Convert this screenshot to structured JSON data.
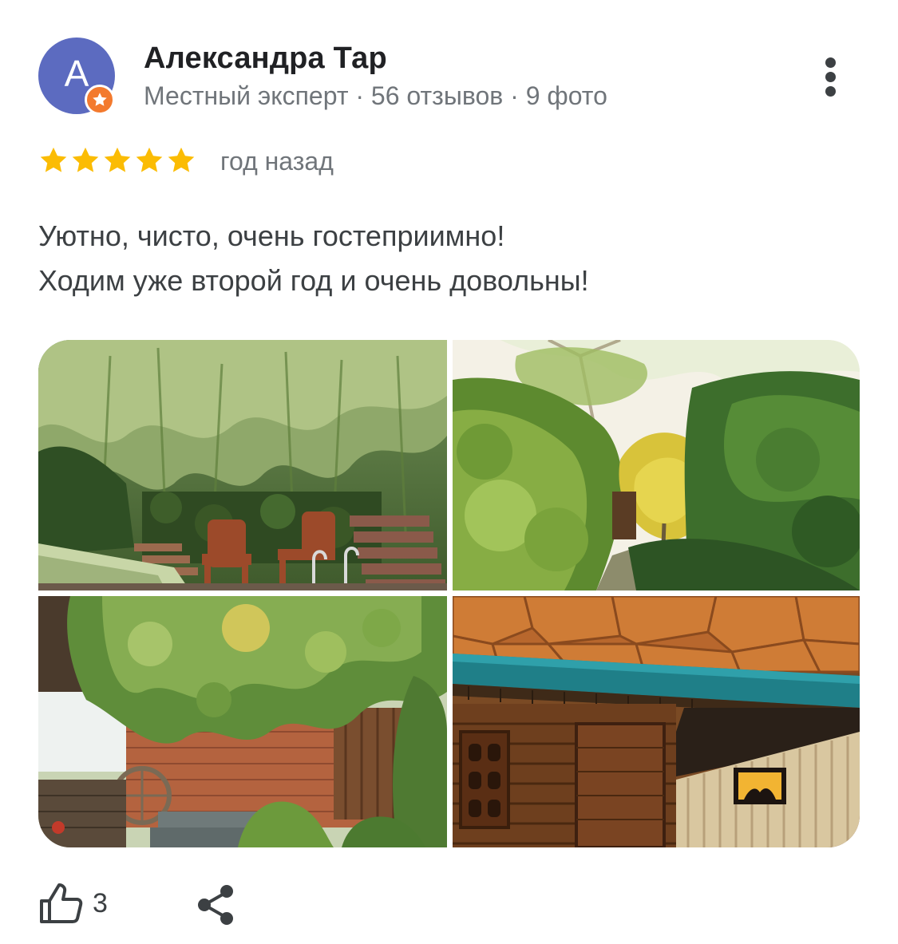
{
  "author": {
    "avatar_letter": "A",
    "avatar_color": "#5c6bc0",
    "badge_icon": "local-guide-star-icon",
    "badge_color": "#f37a2e",
    "name": "Александра Тар",
    "meta": "Местный эксперт · 56 отзывов · 9 фото"
  },
  "rating": {
    "stars": 5,
    "max": 5,
    "star_color": "#fbbc04",
    "time": "год назад"
  },
  "review": {
    "lines": [
      "Уютно, чисто, очень гостеприимно!",
      "Ходим уже второй год и очень довольны!"
    ]
  },
  "photos": [
    {
      "icon": "photo-garden-pool-chairs"
    },
    {
      "icon": "photo-garden-greenery"
    },
    {
      "icon": "photo-brick-wall-vines"
    },
    {
      "icon": "photo-wooden-interior-lamp"
    }
  ],
  "actions": {
    "like_icon": "thumbs-up-icon",
    "like_count": "3",
    "share_icon": "share-icon",
    "more_icon": "more-vertical-icon"
  }
}
